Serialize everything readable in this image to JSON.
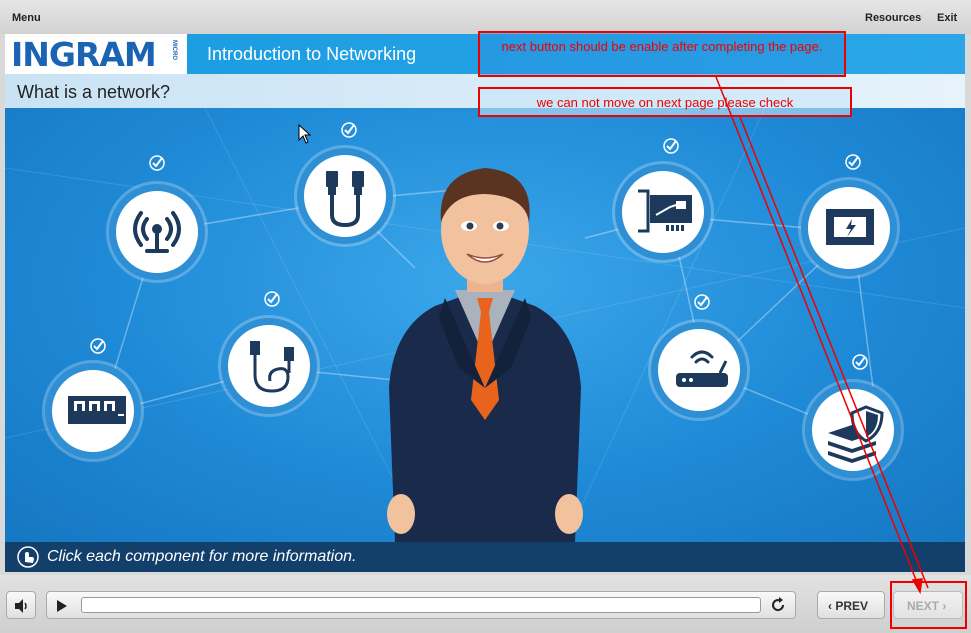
{
  "topbar": {
    "menu": "Menu",
    "resources": "Resources",
    "exit": "Exit"
  },
  "header": {
    "logo": "INGRAM",
    "logo_sub": "MICRO",
    "course_title": "Introduction to Networking"
  },
  "page": {
    "title": "What is a network?"
  },
  "instruction": "Click each component for more information.",
  "nodes": [
    {
      "name": "wireless-antenna",
      "icon": "antenna-icon",
      "visited": true
    },
    {
      "name": "ethernet-cable",
      "icon": "ethernet-cable-icon",
      "visited": true
    },
    {
      "name": "usb-cable",
      "icon": "usb-cable-icon",
      "visited": true
    },
    {
      "name": "switch",
      "icon": "switch-icon",
      "visited": true
    },
    {
      "name": "network-card",
      "icon": "network-card-icon",
      "visited": true
    },
    {
      "name": "ethernet-port",
      "icon": "ethernet-port-icon",
      "visited": true
    },
    {
      "name": "router",
      "icon": "router-icon",
      "visited": true
    },
    {
      "name": "security-server",
      "icon": "server-shield-icon",
      "visited": true
    }
  ],
  "player": {
    "prev_label": "PREV",
    "next_label": "NEXT",
    "next_enabled": false
  },
  "annotations": {
    "note1": "next button should be enable after completing the page.",
    "note2": "we can not move on next page please check"
  },
  "colors": {
    "brand": "#1b63b3",
    "header": "#1a9be0",
    "annotation": "#e00000"
  }
}
